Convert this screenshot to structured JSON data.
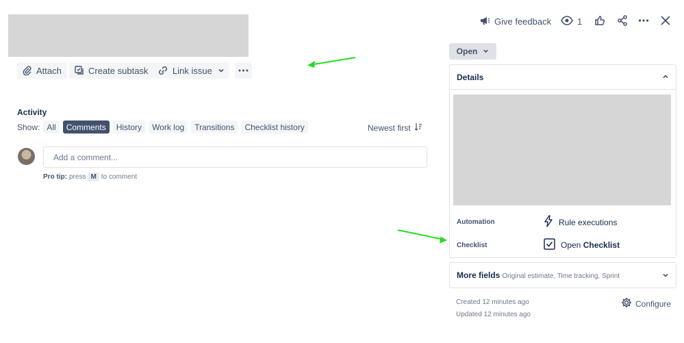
{
  "toolbar": {
    "attach_label": "Attach",
    "create_subtask_label": "Create subtask",
    "link_issue_label": "Link issue"
  },
  "topbar": {
    "feedback_label": "Give feedback",
    "watchers_count": "1"
  },
  "activity": {
    "title": "Activity",
    "show_label": "Show:",
    "filters": [
      "All",
      "Comments",
      "History",
      "Work log",
      "Transitions",
      "Checklist history"
    ],
    "active_filter": "Comments",
    "sort_label": "Newest first"
  },
  "comment": {
    "placeholder": "Add a comment...",
    "protip_bold": "Pro tip:",
    "protip_pre": "press",
    "protip_key": "M",
    "protip_post": "to comment"
  },
  "status": {
    "label": "Open"
  },
  "details": {
    "title": "Details",
    "automation_label": "Automation",
    "automation_value": "Rule executions",
    "checklist_label": "Checklist",
    "checklist_value_pre": "Open",
    "checklist_value_bold": "Checklist"
  },
  "more_fields": {
    "title": "More fields",
    "subtitle": "Original estimate, Time tracking, Sprint"
  },
  "meta": {
    "created": "Created 12 minutes ago",
    "updated": "Updated 12 minutes ago",
    "configure_label": "Configure"
  },
  "colors": {
    "arrow": "#22dd22",
    "active_chip": "#42526e",
    "placeholder": "#d6d6d6"
  },
  "icons": {
    "attach": "paperclip-icon",
    "subtask": "subtask-icon",
    "link": "link-icon",
    "feedback": "megaphone-icon",
    "watch": "eye-icon",
    "like": "thumbs-up-icon",
    "share": "share-icon",
    "more": "more-icon",
    "close": "close-icon",
    "automation": "lightning-icon",
    "checklist": "checkbox-icon",
    "configure": "gear-icon"
  }
}
